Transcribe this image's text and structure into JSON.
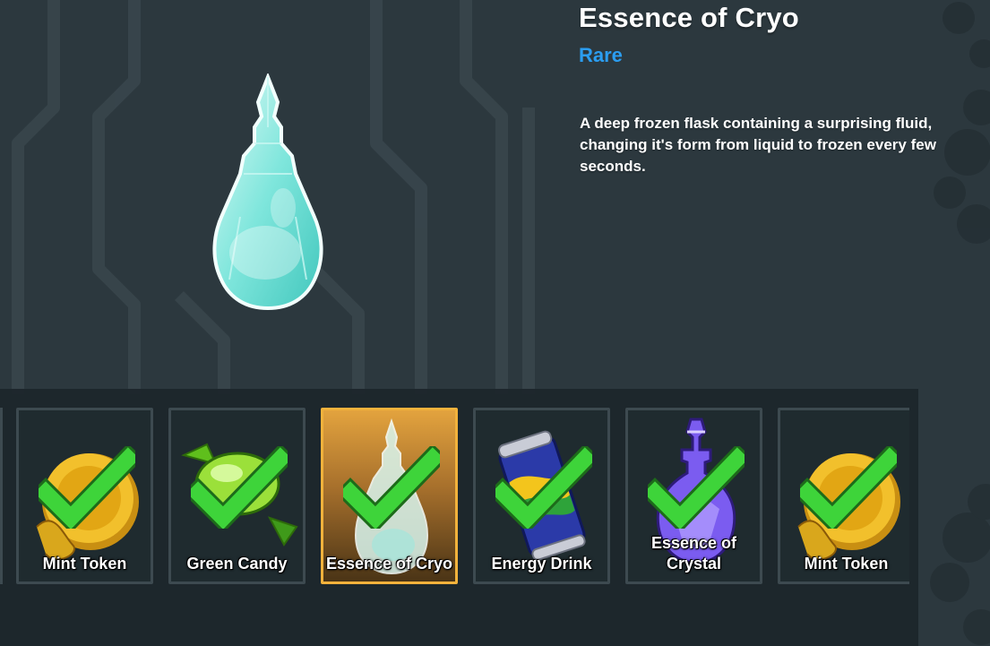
{
  "item": {
    "name": "Essence of Cryo",
    "rarity": "Rare",
    "rarity_color": "#2b9df0",
    "description": "A deep frozen flask containing a surprising fluid, changing it's form from liquid to frozen every few seconds.",
    "icon": "cryo-flask-icon"
  },
  "inventory": {
    "slots": [
      {
        "label": "Mint Token",
        "icon": "mint-token-icon",
        "collected": true,
        "selected": false
      },
      {
        "label": "Green Candy",
        "icon": "green-candy-icon",
        "collected": true,
        "selected": false
      },
      {
        "label": "Essence of Cryo",
        "icon": "cryo-flask-icon",
        "collected": true,
        "selected": true
      },
      {
        "label": "Energy Drink",
        "icon": "energy-drink-icon",
        "collected": true,
        "selected": false
      },
      {
        "label": "Essence of Crystal",
        "icon": "crystal-flask-icon",
        "collected": true,
        "selected": false
      },
      {
        "label": "Mint Token",
        "icon": "mint-token-icon",
        "collected": true,
        "selected": false
      }
    ]
  },
  "colors": {
    "background": "#2c383e",
    "selected_border": "#f2b23c",
    "check": "#3ed43a"
  }
}
